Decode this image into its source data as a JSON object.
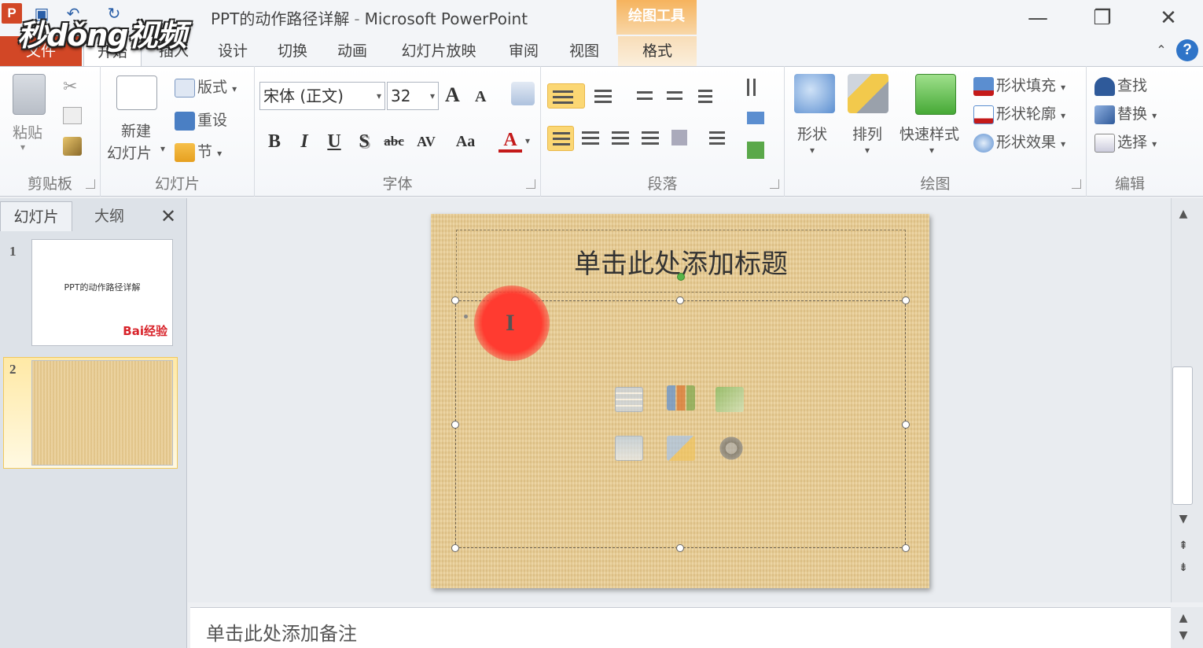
{
  "window": {
    "app_icon": "P",
    "title": "PPT的动作路径详解",
    "app_name": "Microsoft PowerPoint",
    "separator": "-",
    "watermark": "秒dǒng视频",
    "context_group": "绘图工具"
  },
  "qat": {
    "save_icon": "save-icon",
    "undo_icon": "undo-icon",
    "redo_icon": "redo-icon"
  },
  "window_controls": {
    "minimize": "—",
    "restore": "❐",
    "close": "✕"
  },
  "tabs": [
    {
      "label": "文件"
    },
    {
      "label": "开始"
    },
    {
      "label": "插入"
    },
    {
      "label": "设计"
    },
    {
      "label": "切换"
    },
    {
      "label": "动画"
    },
    {
      "label": "幻灯片放映"
    },
    {
      "label": "审阅"
    },
    {
      "label": "视图"
    },
    {
      "label": "格式"
    }
  ],
  "help_label": "?",
  "ribbon": {
    "clipboard": {
      "label": "剪贴板",
      "paste": "粘贴"
    },
    "slides": {
      "label": "幻灯片",
      "new_slide_line1": "新建",
      "new_slide_line2": "幻灯片",
      "layout": "版式",
      "reset": "重设",
      "section": "节"
    },
    "font": {
      "label": "字体",
      "font_name": "宋体 (正文)",
      "font_size": "32",
      "bold": "B",
      "italic": "I",
      "underline": "U",
      "shadow": "S",
      "strike": "abc",
      "spacing": "AV",
      "case": "Aa",
      "color": "A",
      "grow": "A",
      "shrink": "A"
    },
    "paragraph": {
      "label": "段落"
    },
    "drawing": {
      "label": "绘图",
      "shapes": "形状",
      "arrange": "排列",
      "quick_styles": "快速样式",
      "shape_fill": "形状填充",
      "shape_outline": "形状轮廓",
      "shape_effects": "形状效果"
    },
    "editing": {
      "label": "编辑",
      "find": "查找",
      "replace": "替换",
      "select": "选择"
    }
  },
  "pane": {
    "tab_slides": "幻灯片",
    "tab_outline": "大纲",
    "close": "✕",
    "thumbs": [
      {
        "num": "1",
        "title": "PPT的动作路径详解",
        "logo": "Bai经验"
      },
      {
        "num": "2"
      }
    ]
  },
  "slide": {
    "title_placeholder": "单击此处添加标题",
    "cursor": "I"
  },
  "notes": {
    "placeholder": "单击此处添加备注"
  },
  "colors": {
    "file_tab": "#d24726",
    "context_tab": "#f6b35d",
    "highlight": "#fbd774",
    "slide_bg": "#e8cc92",
    "cursor_ring": "#ff3b30"
  }
}
